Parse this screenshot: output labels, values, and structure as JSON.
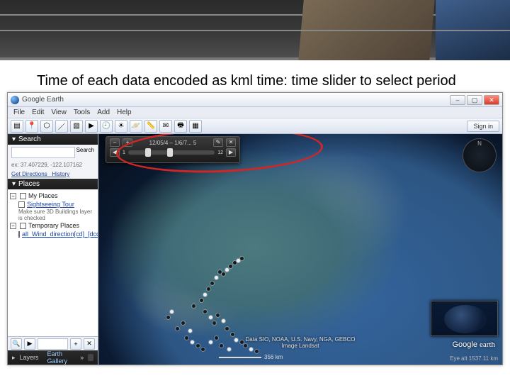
{
  "slide": {
    "caption": "Time of each data encoded as kml time: time slider to select period"
  },
  "window": {
    "title": "Google Earth"
  },
  "menu": {
    "file": "File",
    "edit": "Edit",
    "view": "View",
    "tools": "Tools",
    "add": "Add",
    "help": "Help"
  },
  "toolbar": {
    "signin": "Sign in"
  },
  "search": {
    "panel": "Search",
    "placeholder": "",
    "button": "Search",
    "coord": "ex: 37.407229, -122.107162",
    "getdir": "Get Directions",
    "history": "History"
  },
  "places": {
    "panel": "Places",
    "myplaces": "My Places",
    "sight": "Sightseeing Tour",
    "sight_hint": "Make sure 3D Buildings layer is checked",
    "temp": "Temporary Places",
    "kml": "all_Wind_direction[cd]_[dcc].k..."
  },
  "layers": {
    "panel": "Layers",
    "gallery": "Earth Gallery",
    "more": "»"
  },
  "timeslider": {
    "zoomout": "−",
    "zoomin": "+",
    "range": "12/05/4 – 1/6/7... 5",
    "tick_start": "1",
    "tick_end": "12",
    "wrench": "✎",
    "close": "✕",
    "prev": "◀",
    "next": "▶"
  },
  "map": {
    "attr_line1": "Data SIO, NOAA, U.S. Navy, NGA, GEBCO",
    "attr_line2": "Image Landsat",
    "scale": "356 km",
    "eyealt": "Eye alt 1537.11 km",
    "logo_a": "Google",
    "logo_b": "earth",
    "compass": "N"
  }
}
